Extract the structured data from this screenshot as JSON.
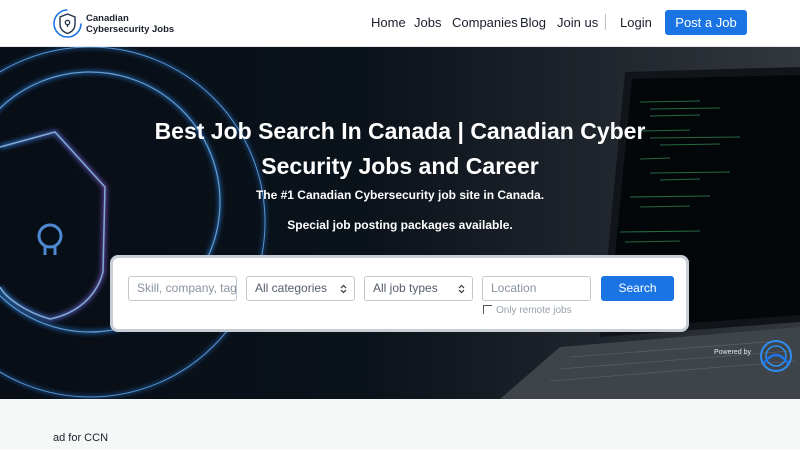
{
  "brand": {
    "name_line1": "Canadian",
    "name_line2": "Cybersecurity Jobs"
  },
  "nav": {
    "items": [
      "Home",
      "Jobs",
      "Companies",
      "Blog",
      "Join us"
    ],
    "login": "Login",
    "post_job": "Post a Job"
  },
  "hero": {
    "title": "Best Job Search In Canada | Canadian Cyber Security Jobs and Career",
    "subtitle": "The #1 Canadian Cybersecurity job site in Canada.",
    "note": "Special job posting packages available."
  },
  "search": {
    "keywords_placeholder": "Skill, company, tag",
    "category_selected": "All categories",
    "job_type_selected": "All job types",
    "location_placeholder": "Location",
    "button": "Search",
    "remote_label": "Only remote jobs",
    "remote_checked": false
  },
  "powered_by": "Powered by",
  "ad_label": "ad for CCN",
  "colors": {
    "accent": "#1b74e4",
    "hero_dark": "#0a111c",
    "glow": "#2f8df0"
  },
  "icons": {
    "logo": "shield-lock-icon",
    "chevron": "chevron-updown-icon",
    "powered_logo": "circular-brand-icon"
  }
}
